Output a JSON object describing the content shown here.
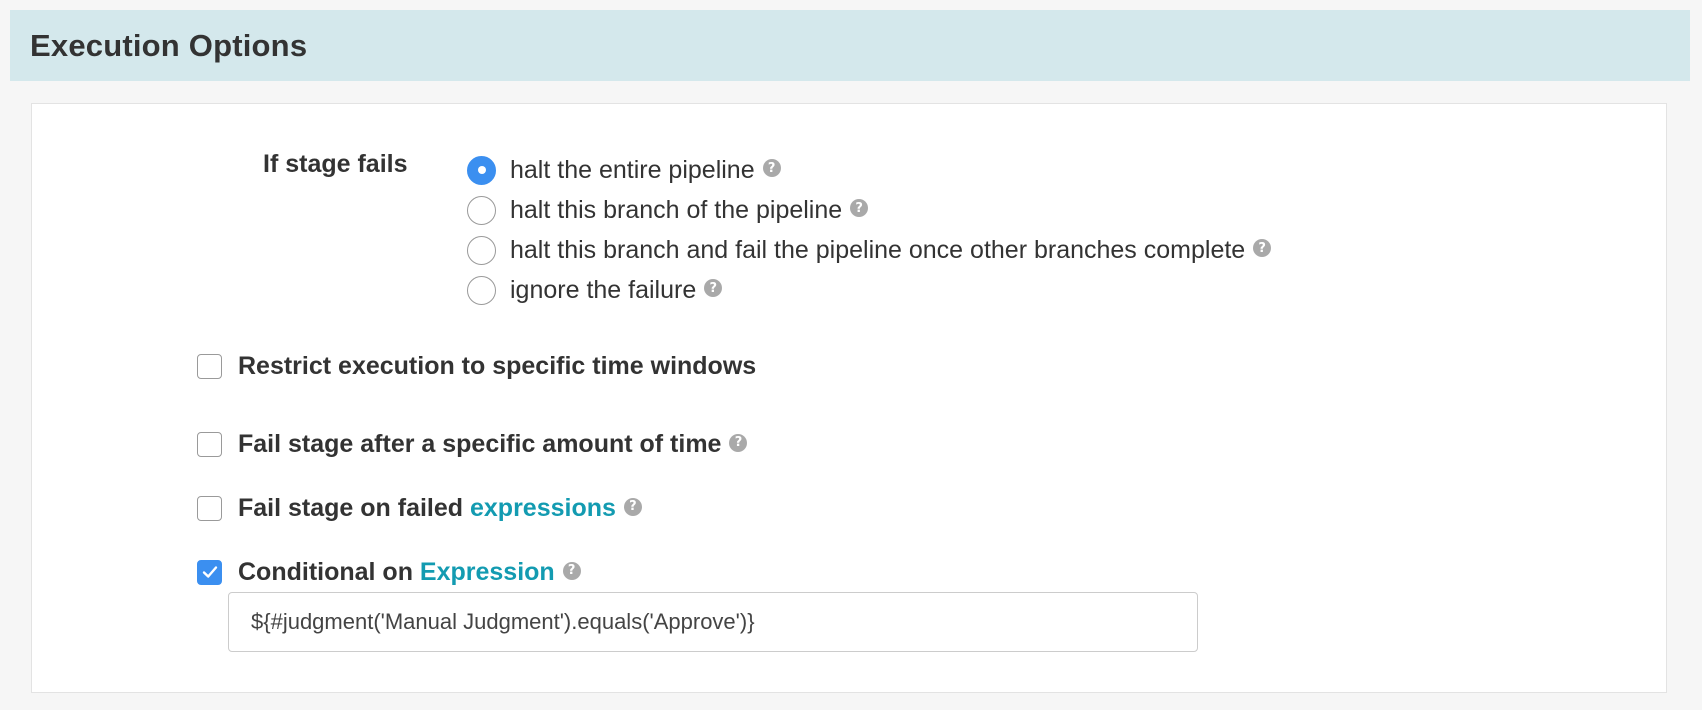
{
  "section": {
    "title": "Execution Options"
  },
  "if_stage_fails": {
    "label": "If stage fails",
    "options": [
      {
        "label": "halt the entire pipeline",
        "selected": true
      },
      {
        "label": "halt this branch of the pipeline",
        "selected": false
      },
      {
        "label": "halt this branch and fail the pipeline once other branches complete",
        "selected": false
      },
      {
        "label": "ignore the failure",
        "selected": false
      }
    ]
  },
  "checkboxes": {
    "restrict_time_windows": {
      "label": "Restrict execution to specific time windows",
      "checked": false
    },
    "fail_after_time": {
      "label": "Fail stage after a specific amount of time",
      "checked": false
    },
    "fail_on_expressions": {
      "label": "Fail stage on failed ",
      "link": "expressions",
      "checked": false
    },
    "conditional_on_expression": {
      "label": "Conditional on ",
      "link": "Expression",
      "checked": true
    }
  },
  "expression_input": {
    "value": "${#judgment('Manual Judgment').equals('Approve')}"
  },
  "help_icon_glyph": "?",
  "colors": {
    "header_bg": "#d4e8ec",
    "accent": "#3b8ff0",
    "link": "#139bb1",
    "help_icon": "#a9a9a9"
  }
}
